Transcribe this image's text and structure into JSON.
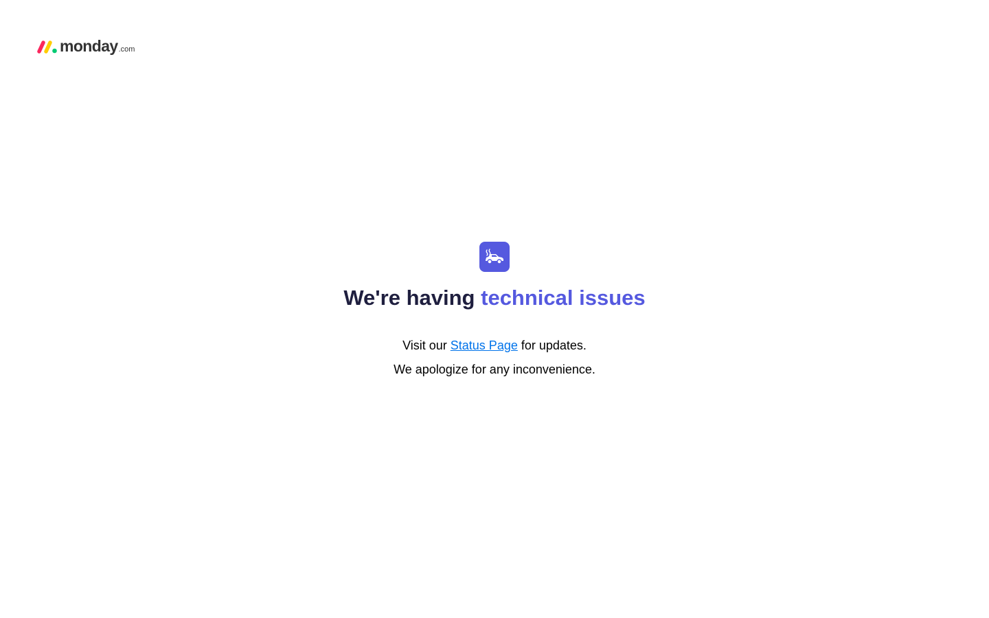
{
  "logo": {
    "word": "monday",
    "tld": ".com",
    "colors": [
      "#fb275d",
      "#ffcc00",
      "#00ca72"
    ]
  },
  "error": {
    "icon": "broken-car-icon",
    "icon_bg": "#5559df",
    "headline_prefix": "We're having",
    "headline_accent": "technical issues",
    "status_prefix": "Visit our",
    "status_link": "Status Page",
    "status_suffix": "for updates.",
    "apology": "We apologize for any inconvenience."
  },
  "colors": {
    "accent": "#5559df",
    "link": "#0073ea",
    "heading": "#1f1f3f"
  }
}
